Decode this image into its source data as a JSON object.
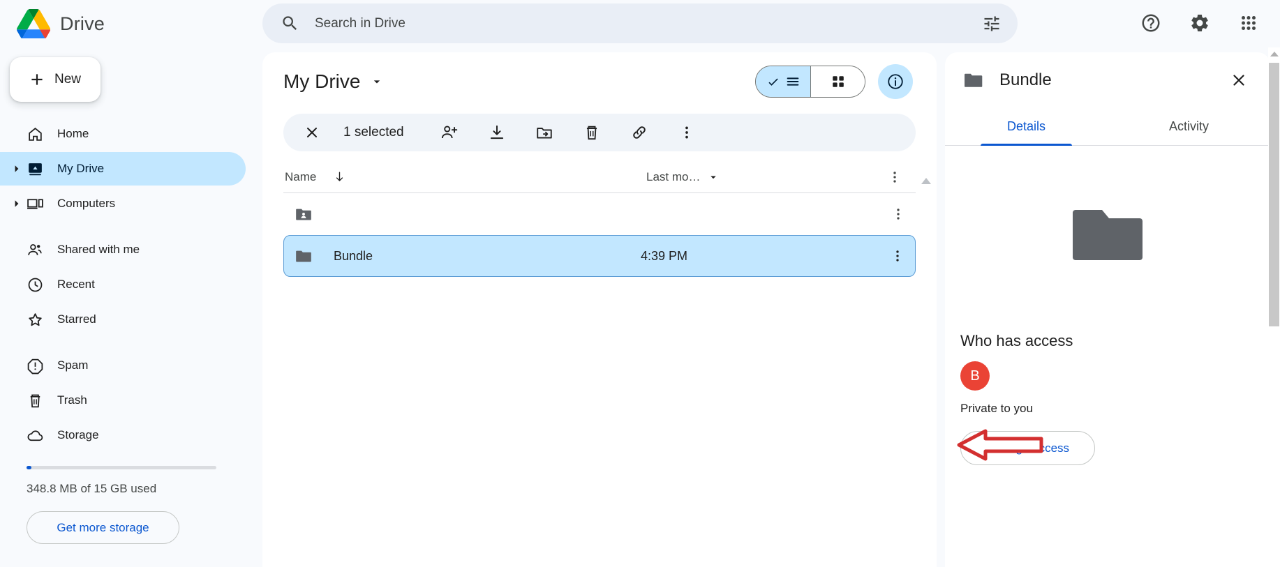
{
  "app": {
    "brand": "Drive",
    "logo_colors": {
      "blue": "#1a73e8",
      "green": "#1e8e3e",
      "yellow": "#fbbc04",
      "red": "#ea4335"
    }
  },
  "search": {
    "placeholder": "Search in Drive",
    "value": "",
    "icon": "search-icon",
    "filter_icon": "tune-filter-icon"
  },
  "topbar_actions": [
    {
      "name": "help-icon",
      "label": "Support"
    },
    {
      "name": "gear-icon",
      "label": "Settings"
    },
    {
      "name": "apps-grid-icon",
      "label": "Google apps"
    }
  ],
  "sidebar": {
    "new_button": "New",
    "items": [
      {
        "label": "Home",
        "icon": "home-icon",
        "active": false,
        "expandable": false
      },
      {
        "label": "My Drive",
        "icon": "my-drive-icon",
        "active": true,
        "expandable": true
      },
      {
        "label": "Computers",
        "icon": "computer-icon",
        "active": false,
        "expandable": true
      },
      {
        "label": "Shared with me",
        "icon": "people-icon",
        "active": false,
        "expandable": false
      },
      {
        "label": "Recent",
        "icon": "clock-icon",
        "active": false,
        "expandable": false
      },
      {
        "label": "Starred",
        "icon": "star-icon",
        "active": false,
        "expandable": false
      },
      {
        "label": "Spam",
        "icon": "spam-icon",
        "active": false,
        "expandable": false
      },
      {
        "label": "Trash",
        "icon": "trash-icon",
        "active": false,
        "expandable": false
      },
      {
        "label": "Storage",
        "icon": "cloud-icon",
        "active": false,
        "expandable": false
      }
    ],
    "storage": {
      "text": "348.8 MB of 15 GB used",
      "percent": 2.3,
      "bar_color": "#0b57d0",
      "button": "Get more storage"
    }
  },
  "main": {
    "title": "My Drive",
    "title_caret": "chevron-down-icon",
    "view_toggle": {
      "list_label": "List layout",
      "grid_label": "Grid layout",
      "selected": "list",
      "selected_bg": "#c2e7ff"
    },
    "info_button": "View details",
    "selection_toolbar": {
      "close": "Clear selection",
      "count_text": "1 selected",
      "actions": [
        {
          "name": "share-person-add-icon",
          "label": "Share"
        },
        {
          "name": "download-icon",
          "label": "Download"
        },
        {
          "name": "move-to-folder-icon",
          "label": "Move"
        },
        {
          "name": "trash-icon",
          "label": "Remove"
        },
        {
          "name": "link-icon",
          "label": "Get link"
        },
        {
          "name": "more-vert-icon",
          "label": "More actions"
        }
      ]
    },
    "table": {
      "columns": [
        {
          "label": "Name",
          "sort_icon": "arrow-down-icon"
        },
        {
          "label": "Last mo…",
          "sort_icon": "chevron-down-icon"
        }
      ],
      "rows": [
        {
          "name": "",
          "icon": "shared-folder-icon",
          "modified": "",
          "selected": false
        },
        {
          "name": "Bundle",
          "icon": "folder-icon",
          "modified": "4:39 PM",
          "selected": true
        }
      ]
    }
  },
  "details_panel": {
    "title": "Bundle",
    "icon": "folder-icon",
    "close": "Close",
    "tabs": [
      {
        "label": "Details",
        "active": true
      },
      {
        "label": "Activity",
        "active": false
      }
    ],
    "preview_icon": "large-folder-icon",
    "access": {
      "heading": "Who has access",
      "avatar_letter": "B",
      "avatar_color": "#ea4335",
      "status": "Private to you",
      "manage_button": "Manage access"
    }
  },
  "annotation": {
    "type": "arrow",
    "color": "#d32f2f",
    "points_to": "Manage access"
  }
}
